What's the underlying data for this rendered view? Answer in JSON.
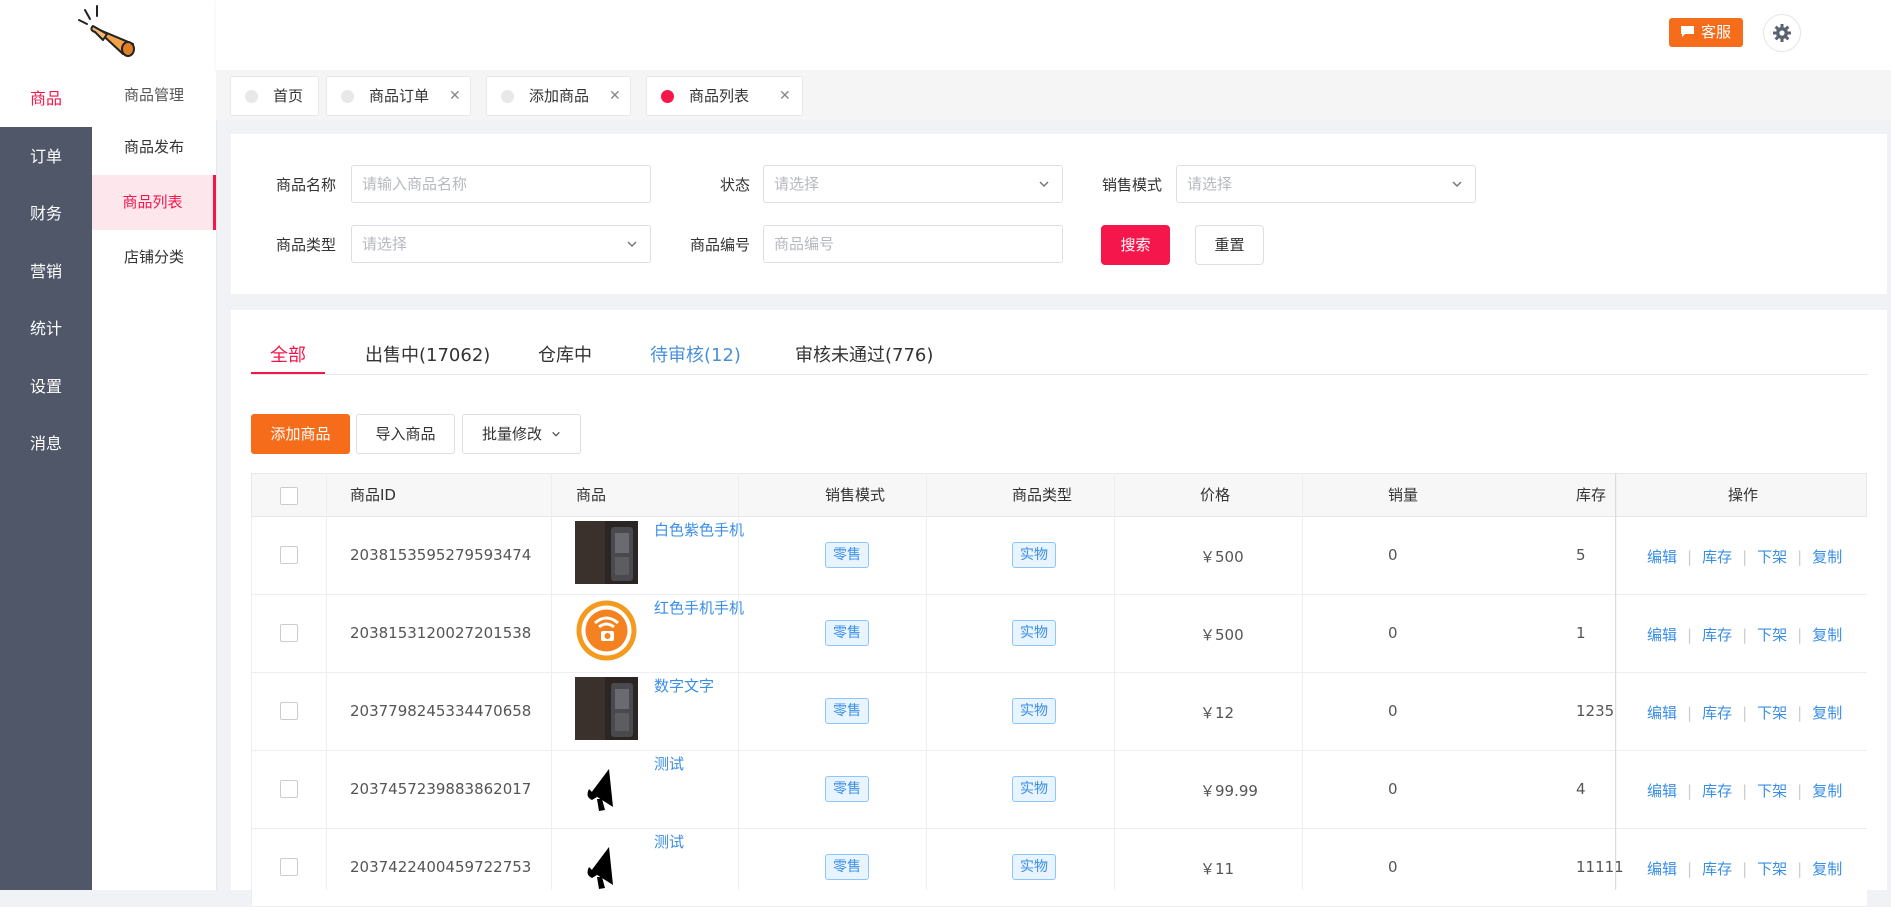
{
  "sidebar": {
    "primary": [
      {
        "label": "商品",
        "active": true
      },
      {
        "label": "订单"
      },
      {
        "label": "财务"
      },
      {
        "label": "营销"
      },
      {
        "label": "统计"
      },
      {
        "label": "设置"
      },
      {
        "label": "消息"
      }
    ],
    "secondary_header": "商品管理",
    "secondary": [
      {
        "label": "商品发布"
      },
      {
        "label": "商品列表",
        "active": true
      },
      {
        "label": "店铺分类"
      }
    ]
  },
  "header": {
    "service_label": "客服",
    "settings_icon": "gear-icon"
  },
  "page_tabs": [
    {
      "label": "首页",
      "closable": false
    },
    {
      "label": "商品订单",
      "closable": true
    },
    {
      "label": "添加商品",
      "closable": true
    },
    {
      "label": "商品列表",
      "closable": true,
      "active": true
    }
  ],
  "close_glyph": "✕",
  "filters": {
    "name_label": "商品名称",
    "name_placeholder": "请输入商品名称",
    "status_label": "状态",
    "status_placeholder": "请选择",
    "sale_mode_label": "销售模式",
    "sale_mode_placeholder": "请选择",
    "type_label": "商品类型",
    "type_placeholder": "请选择",
    "code_label": "商品编号",
    "code_placeholder": "商品编号",
    "search_label": "搜索",
    "reset_label": "重置"
  },
  "status_tabs": [
    {
      "label": "全部",
      "active": true
    },
    {
      "label": "出售中(17062)"
    },
    {
      "label": "仓库中"
    },
    {
      "label": "待审核(12)"
    },
    {
      "label": "审核未通过(776)"
    }
  ],
  "actions": {
    "add_label": "添加商品",
    "import_label": "导入商品",
    "batch_label": "批量修改"
  },
  "table": {
    "columns": [
      "商品ID",
      "商品",
      "销售模式",
      "商品类型",
      "价格",
      "销量",
      "库存",
      "操作"
    ],
    "operations": [
      "编辑",
      "库存",
      "下架",
      "复制"
    ],
    "rows": [
      {
        "id": "2038153595279593474",
        "name": "白色紫色手机",
        "thumb": "phone",
        "mode": "零售",
        "type": "实物",
        "price": "￥500",
        "sales": "0",
        "stock": "5"
      },
      {
        "id": "2038153120027201538",
        "name": "红色手机手机",
        "thumb": "logo",
        "mode": "零售",
        "type": "实物",
        "price": "￥500",
        "sales": "0",
        "stock": "1"
      },
      {
        "id": "2037798245334470658",
        "name": "数字文字",
        "thumb": "phone",
        "mode": "零售",
        "type": "实物",
        "price": "￥12",
        "sales": "0",
        "stock": "1235"
      },
      {
        "id": "2037457239883862017",
        "name": "测试",
        "thumb": "megaphone",
        "mode": "零售",
        "type": "实物",
        "price": "￥99.99",
        "sales": "0",
        "stock": "4"
      },
      {
        "id": "2037422400459722753",
        "name": "测试",
        "thumb": "megaphone",
        "mode": "零售",
        "type": "实物",
        "price": "￥11",
        "sales": "0",
        "stock": "11111"
      }
    ]
  },
  "colors": {
    "accent": "#f5174b",
    "orange": "#f56c1b",
    "link": "#3a8ee6",
    "nav_bg": "#505769"
  }
}
